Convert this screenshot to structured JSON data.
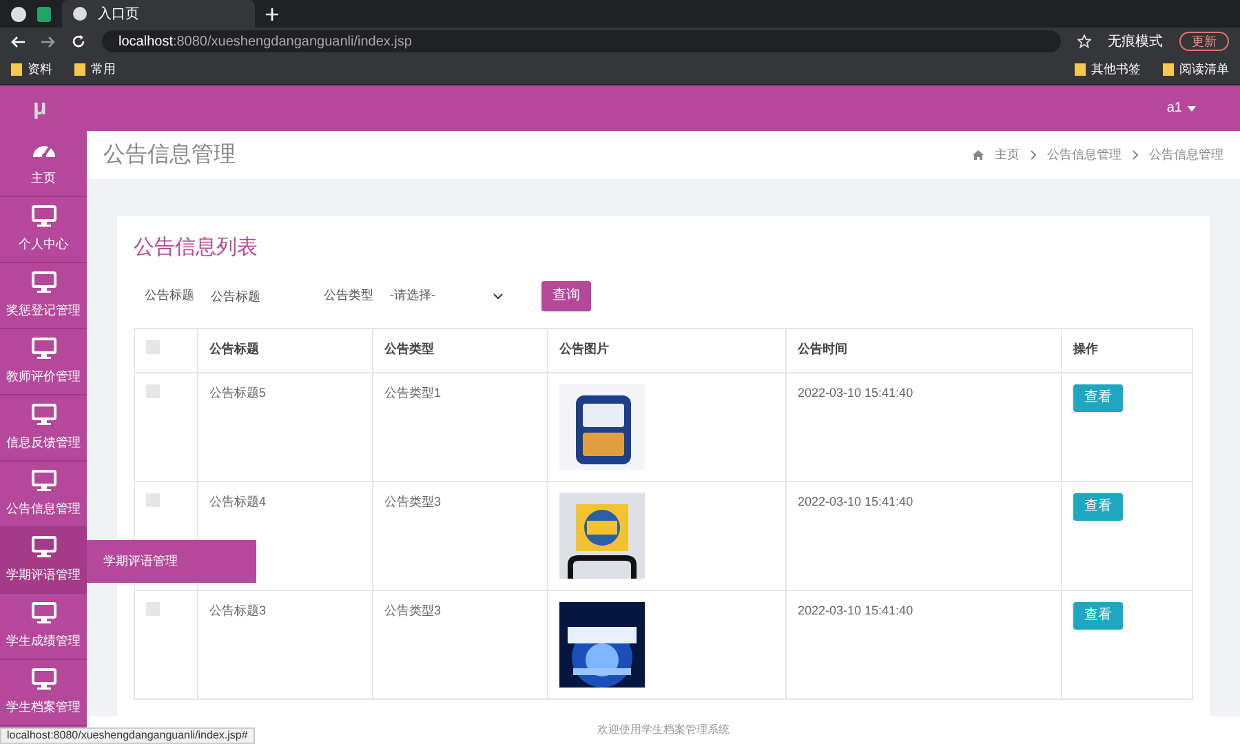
{
  "browser": {
    "tabs": [
      {
        "label": "入口页",
        "selected": true
      }
    ],
    "address": {
      "host": "localhost",
      "path": ":8080/xueshengdanganguanli/index.jsp"
    },
    "profile": "无痕模式",
    "update_button": "更新",
    "bookmarks": [
      "资料",
      "常用"
    ],
    "bookmarks_right": [
      "其他书签",
      "阅读清单"
    ]
  },
  "header": {
    "logo": "μ",
    "user": "a1"
  },
  "sidebar": {
    "items": [
      {
        "label": "主页",
        "kind": "home",
        "selected": false
      },
      {
        "label": "个人中心",
        "kind": "module",
        "selected": false
      },
      {
        "label": "奖惩登记管理",
        "kind": "module",
        "selected": false
      },
      {
        "label": "教师评价管理",
        "kind": "module",
        "selected": false
      },
      {
        "label": "信息反馈管理",
        "kind": "module",
        "selected": false
      },
      {
        "label": "公告信息管理",
        "kind": "module",
        "selected": false
      },
      {
        "label": "学期评语管理",
        "kind": "module",
        "selected": true
      },
      {
        "label": "学生成绩管理",
        "kind": "module",
        "selected": false
      },
      {
        "label": "学生档案管理",
        "kind": "module",
        "selected": false
      }
    ],
    "flyout": {
      "items": [
        "学期评语管理"
      ]
    }
  },
  "page_header": {
    "title": "公告信息管理",
    "breadcrumb": [
      "主页",
      "公告信息管理",
      "公告信息管理"
    ]
  },
  "card": {
    "title": "公告信息列表",
    "filters": [
      {
        "label": "公告标题",
        "placeholder": "公告标题",
        "kind": "input"
      },
      {
        "label": "公告类型",
        "value": "-请选择-",
        "kind": "select"
      }
    ],
    "search_button": "查询",
    "table": {
      "columns": [
        "公告标题",
        "公告类型",
        "公告图片",
        "公告时间",
        "操作"
      ],
      "header_checked": false,
      "rows": [
        {
          "checked": false,
          "title": "公告标题5",
          "type": "公告类型1",
          "time": "2022-03-10 15:41:40",
          "action": "查看"
        },
        {
          "checked": false,
          "title": "公告标题4",
          "type": "公告类型3",
          "time": "2022-03-10 15:41:40",
          "action": "查看"
        },
        {
          "checked": false,
          "title": "公告标题3",
          "type": "公告类型3",
          "time": "2022-03-10 15:41:40",
          "action": "查看"
        }
      ]
    }
  },
  "footer": "欢迎使用学生档案管理系统",
  "status_url": "localhost:8080/xueshengdanganguanli/index.jsp#"
}
